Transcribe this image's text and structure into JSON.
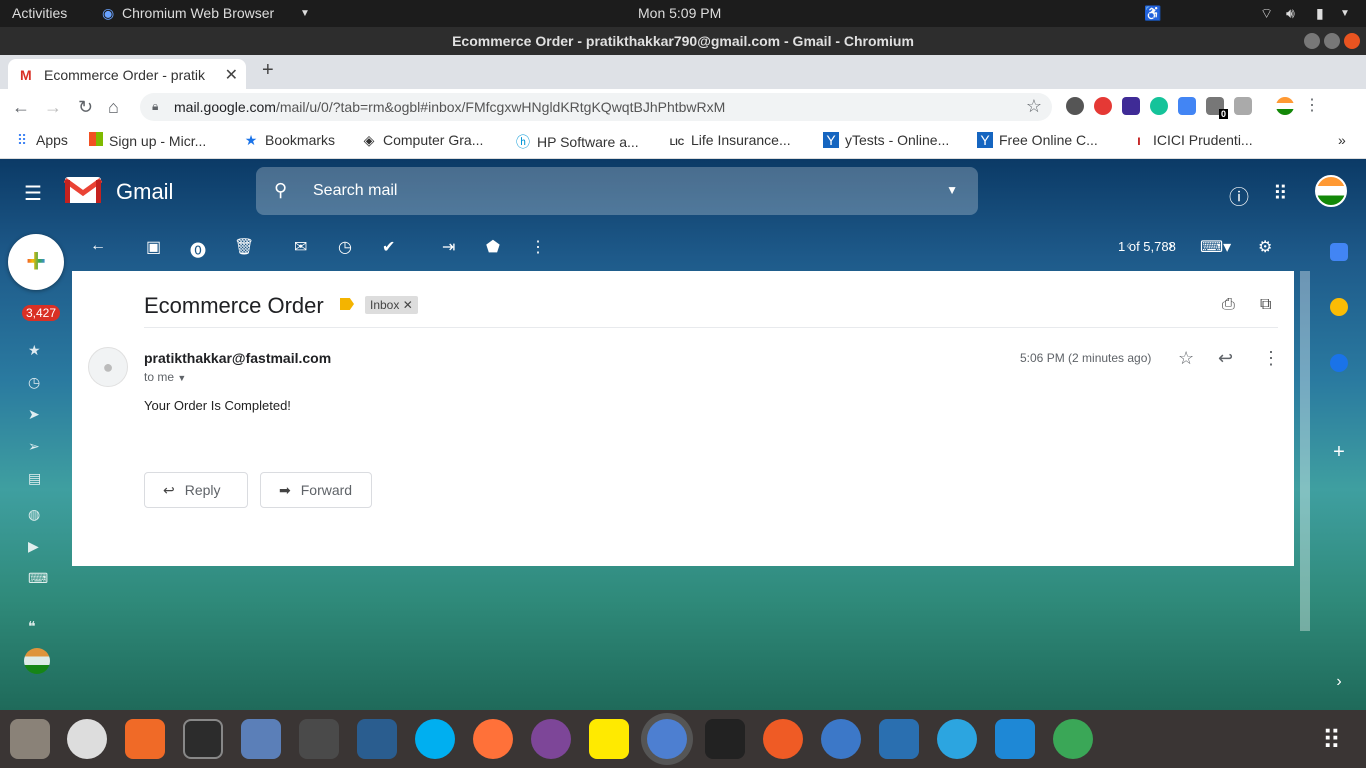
{
  "system": {
    "activities": "Activities",
    "app_name": "Chromium Web Browser",
    "clock": "Mon  5:09 PM"
  },
  "window": {
    "title": "Ecommerce Order - pratikthakkar790@gmail.com - Gmail - Chromium"
  },
  "tab": {
    "title": "Ecommerce Order - pratik"
  },
  "address": {
    "host": "mail.google.com",
    "path": "/mail/u/0/?tab=rm&ogbl#inbox/FMfcgxwHNgldKRtgKQwqtBJhPhtbwRxM"
  },
  "extension_badge": "0",
  "bookmarks": [
    {
      "label": "Apps"
    },
    {
      "label": "Sign up - Micr..."
    },
    {
      "label": "Bookmarks"
    },
    {
      "label": "Computer Gra..."
    },
    {
      "label": "HP Software a..."
    },
    {
      "label": "Life Insurance..."
    },
    {
      "label": "yTests - Online..."
    },
    {
      "label": "Free Online C..."
    },
    {
      "label": "ICICI Prudenti..."
    }
  ],
  "gmail": {
    "brand": "Gmail",
    "search_placeholder": "Search mail",
    "unread_count": "3,427",
    "pagination": "1 of 5,788",
    "message": {
      "subject": "Ecommerce Order",
      "label": "Inbox",
      "sender": "pratikthakkar@fastmail.com",
      "to": "to me",
      "time": "5:06 PM (2 minutes ago)",
      "body": "Your Order Is Completed!",
      "reply_label": "Reply",
      "forward_label": "Forward"
    }
  },
  "colors": {
    "accent_red": "#d93025",
    "important_yellow": "#f4b400",
    "ubuntu_orange": "#e95420"
  }
}
